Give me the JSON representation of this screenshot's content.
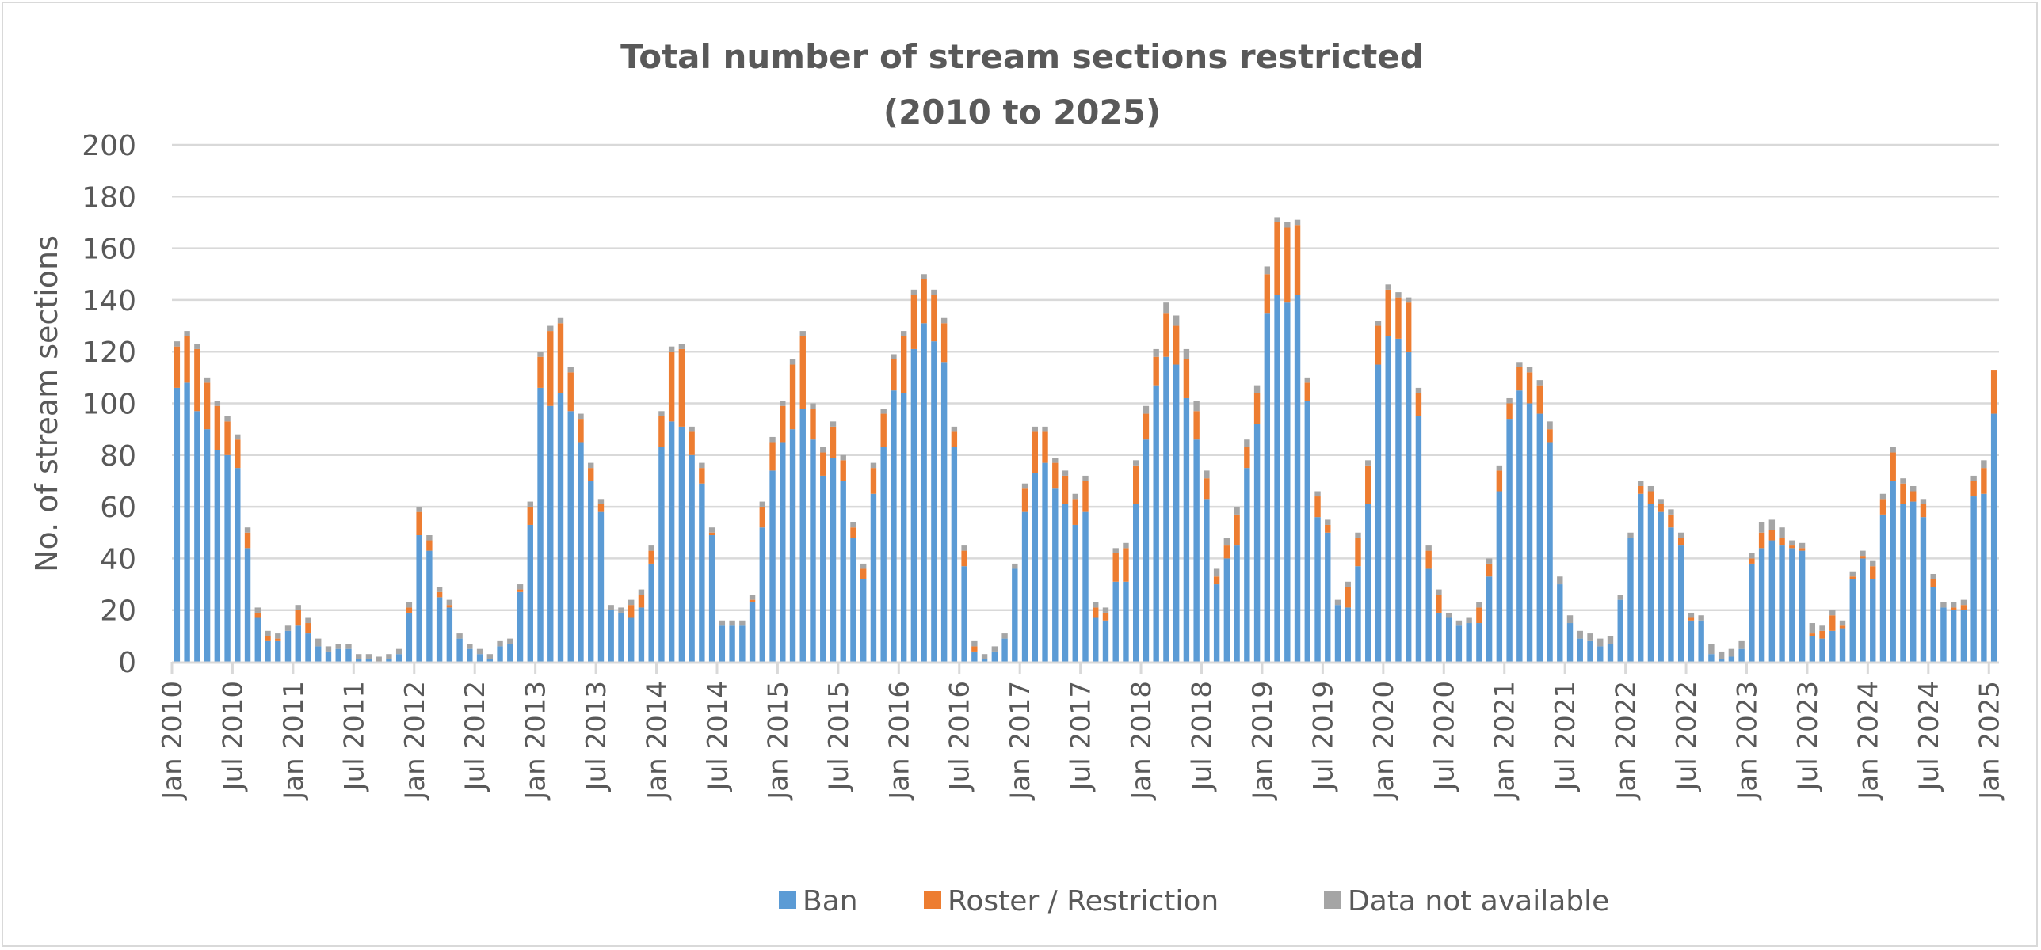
{
  "chart_data": {
    "type": "bar",
    "stacked": true,
    "title": "Total number of stream sections restricted",
    "subtitle": "(2010 to 2025)",
    "xlabel": "",
    "ylabel": "No. of stream sections",
    "ylim": [
      0,
      200
    ],
    "yticks": [
      0,
      20,
      40,
      60,
      80,
      100,
      120,
      140,
      160,
      180,
      200
    ],
    "grid": true,
    "legend_position": "bottom",
    "x_start": "Jan 2010",
    "x_end": "Jan 2025",
    "x_frequency": "monthly",
    "xtick_labels": [
      "Jan 2010",
      "Jul 2010",
      "Jan 2011",
      "Jul 2011",
      "Jan 2012",
      "Jul 2012",
      "Jan 2013",
      "Jul 2013",
      "Jan 2014",
      "Jul 2014",
      "Jan 2015",
      "Jul 2015",
      "Jan 2016",
      "Jul 2016",
      "Jan 2017",
      "Jul 2017",
      "Jan 2018",
      "Jul 2018",
      "Jan 2019",
      "Jul 2019",
      "Jan 2020",
      "Jul 2020",
      "Jan 2021",
      "Jul 2021",
      "Jan 2022",
      "Jul 2022",
      "Jan 2023",
      "Jul 2023",
      "Jan 2024",
      "Jul 2024",
      "Jan 2025"
    ],
    "series": [
      {
        "name": "Ban",
        "color": "#5b9bd5",
        "values": [
          106,
          108,
          97,
          90,
          82,
          80,
          75,
          44,
          17,
          8,
          8,
          12,
          14,
          11,
          6,
          4,
          5,
          5,
          1,
          1,
          0,
          1,
          3,
          19,
          49,
          43,
          25,
          21,
          9,
          5,
          3,
          1,
          6,
          7,
          27,
          53,
          106,
          99,
          104,
          97,
          85,
          70,
          58,
          20,
          19,
          17,
          21,
          38,
          83,
          93,
          91,
          80,
          69,
          49,
          14,
          14,
          14,
          23,
          52,
          74,
          85,
          90,
          98,
          86,
          72,
          79,
          70,
          48,
          32,
          65,
          83,
          105,
          104,
          121,
          131,
          124,
          116,
          83,
          37,
          4,
          1,
          4,
          9,
          36,
          58,
          73,
          77,
          67,
          61,
          53,
          58,
          17,
          16,
          31,
          31,
          61,
          86,
          107,
          118,
          115,
          102,
          86,
          63,
          30,
          40,
          45,
          75,
          92,
          135,
          142,
          139,
          142,
          101,
          56,
          50,
          22,
          21,
          37,
          61,
          115,
          126,
          125,
          120,
          95,
          36,
          19,
          17,
          14,
          15,
          15,
          33,
          66,
          94,
          105,
          100,
          96,
          85,
          30,
          15,
          9,
          8,
          6,
          7,
          24,
          48,
          65,
          61,
          58,
          52,
          45,
          16,
          16,
          3,
          1,
          2,
          5,
          38,
          44,
          47,
          45,
          44,
          43,
          10,
          9,
          12,
          13,
          32,
          40,
          32,
          57,
          70,
          61,
          62,
          56,
          29,
          21,
          20,
          20,
          64,
          65,
          96
        ]
      },
      {
        "name": "Roster / Restriction",
        "color": "#ed7d31",
        "values": [
          16,
          18,
          24,
          18,
          17,
          13,
          11,
          6,
          2,
          2,
          1,
          0,
          6,
          4,
          0,
          0,
          0,
          0,
          0,
          0,
          0,
          0,
          0,
          2,
          9,
          4,
          2,
          1,
          0,
          0,
          0,
          0,
          0,
          0,
          1,
          7,
          12,
          29,
          27,
          15,
          9,
          5,
          3,
          0,
          0,
          5,
          5,
          5,
          12,
          27,
          30,
          9,
          6,
          1,
          0,
          0,
          0,
          1,
          8,
          11,
          14,
          25,
          28,
          12,
          9,
          12,
          8,
          4,
          4,
          10,
          13,
          12,
          22,
          21,
          17,
          18,
          15,
          6,
          6,
          2,
          0,
          0,
          0,
          0,
          9,
          16,
          12,
          10,
          11,
          10,
          12,
          4,
          3,
          11,
          13,
          15,
          10,
          11,
          17,
          15,
          15,
          11,
          8,
          3,
          5,
          12,
          8,
          12,
          15,
          28,
          29,
          27,
          7,
          8,
          3,
          0,
          8,
          11,
          15,
          15,
          18,
          16,
          19,
          9,
          7,
          7,
          0,
          0,
          0,
          6,
          5,
          8,
          6,
          9,
          12,
          11,
          5,
          0,
          0,
          0,
          0,
          0,
          0,
          0,
          0,
          3,
          5,
          3,
          5,
          3,
          1,
          0,
          0,
          0,
          0,
          0,
          2,
          6,
          4,
          3,
          1,
          1,
          1,
          3,
          6,
          1,
          1,
          1,
          5,
          6,
          11,
          8,
          4,
          5,
          3,
          0,
          1,
          2,
          6,
          10,
          17
        ]
      },
      {
        "name": "Data not available",
        "color": "#a5a5a5",
        "values": [
          2,
          2,
          2,
          2,
          2,
          2,
          2,
          2,
          2,
          2,
          2,
          2,
          2,
          2,
          3,
          2,
          2,
          2,
          2,
          2,
          2,
          2,
          2,
          2,
          2,
          2,
          2,
          2,
          2,
          2,
          2,
          2,
          2,
          2,
          2,
          2,
          2,
          2,
          2,
          2,
          2,
          2,
          2,
          2,
          2,
          2,
          2,
          2,
          2,
          2,
          2,
          2,
          2,
          2,
          2,
          2,
          2,
          2,
          2,
          2,
          2,
          2,
          2,
          2,
          2,
          2,
          2,
          2,
          2,
          2,
          2,
          2,
          2,
          2,
          2,
          2,
          2,
          2,
          2,
          2,
          2,
          2,
          2,
          2,
          2,
          2,
          2,
          2,
          2,
          2,
          2,
          2,
          2,
          2,
          2,
          2,
          3,
          3,
          4,
          4,
          4,
          4,
          3,
          3,
          3,
          3,
          3,
          3,
          3,
          2,
          2,
          2,
          2,
          2,
          2,
          2,
          2,
          2,
          2,
          2,
          2,
          2,
          2,
          2,
          2,
          2,
          2,
          2,
          2,
          2,
          2,
          2,
          2,
          2,
          2,
          2,
          3,
          3,
          3,
          3,
          3,
          3,
          3,
          2,
          2,
          2,
          2,
          2,
          2,
          2,
          2,
          2,
          4,
          3,
          3,
          3,
          2,
          4,
          4,
          4,
          2,
          2,
          4,
          2,
          2,
          2,
          2,
          2,
          2,
          2,
          2,
          2,
          2,
          2,
          2,
          2,
          2,
          2,
          2,
          3
        ]
      }
    ]
  },
  "legend": {
    "items": [
      {
        "label": "Ban",
        "color": "#5b9bd5"
      },
      {
        "label": "Roster / Restriction",
        "color": "#ed7d31"
      },
      {
        "label": "Data not available",
        "color": "#a5a5a5"
      }
    ]
  }
}
